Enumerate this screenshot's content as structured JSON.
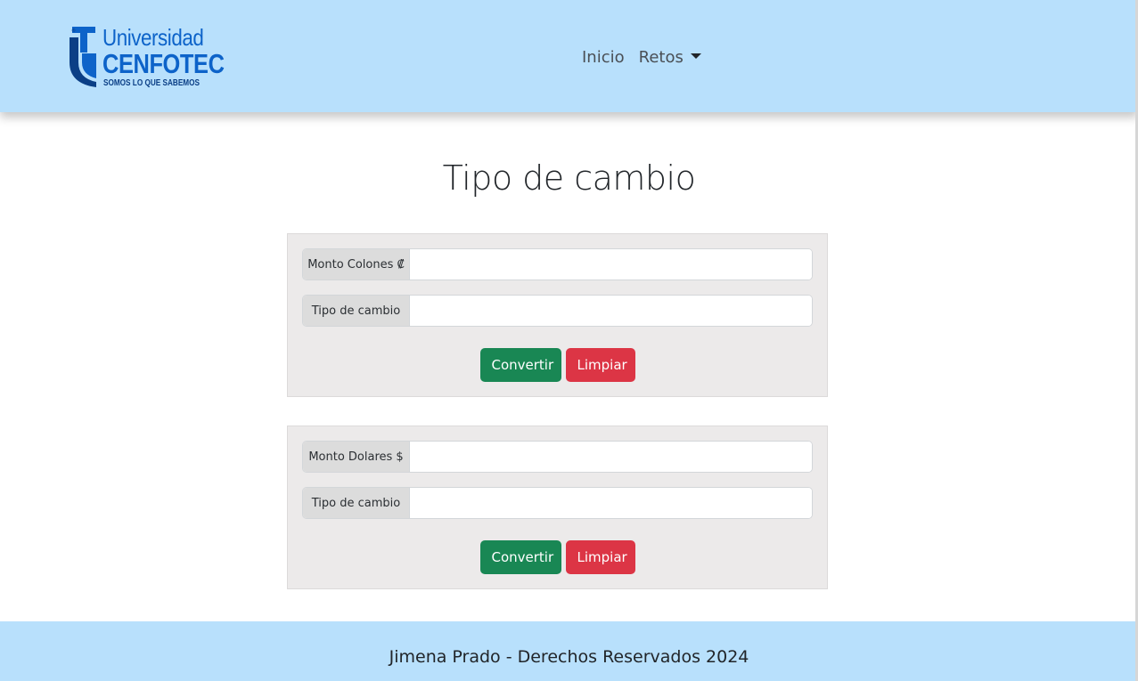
{
  "header": {
    "logo": {
      "line1": "Universidad",
      "line2": "CENFOTEC",
      "tagline": "SOMOS LO QUE SABEMOS"
    },
    "nav": {
      "inicio_label": "Inicio",
      "retos_label": "Retos"
    },
    "colors": {
      "navbar_bg": "#b8e0fc",
      "logo_blue": "#0d63c9"
    }
  },
  "main": {
    "title": "Tipo de cambio",
    "colones_form": {
      "amount_label": "Monto Colones ₡",
      "amount_value": "",
      "rate_label": "Tipo de cambio",
      "rate_value": "",
      "convert_label": "Convertir",
      "clear_label": "Limpiar"
    },
    "dolares_form": {
      "amount_label": "Monto Dolares $",
      "amount_value": "",
      "rate_label": "Tipo de cambio",
      "rate_value": "",
      "convert_label": "Convertir",
      "clear_label": "Limpiar"
    },
    "colors": {
      "convert_btn": "#198754",
      "clear_btn": "#dc3545",
      "card_bg": "#eceaea"
    }
  },
  "footer": {
    "text": "Jimena Prado - Derechos Reservados 2024"
  }
}
